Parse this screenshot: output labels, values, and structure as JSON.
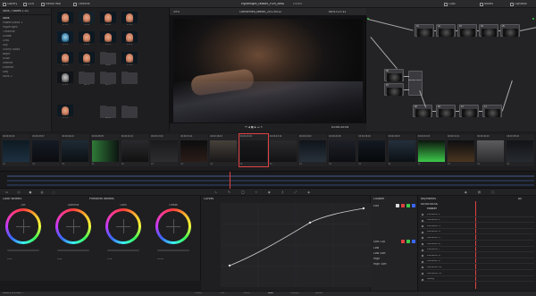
{
  "topbar": {
    "left_items": [
      "Gallery",
      "LUTs",
      "Media Pool",
      "Timeline"
    ],
    "project_title": "Hyperlight_teaser_FOR_BMD",
    "project_status": "Edited",
    "right_items": [
      "Clips",
      "Nodes",
      "Lightbox"
    ],
    "zoom": "49%",
    "viewer_title": "Conformed_teaser_20170512",
    "timecode": "00:57:27:11"
  },
  "gallery": {
    "header": "Stills / Stores 1-01",
    "list": [
      "Stills",
      "PowerGrade 1",
      "Hyperlight",
      "Timeline",
      "Grade",
      "CMA",
      "Sky",
      "Sunny looks",
      "Night",
      "Dusk",
      "Interior",
      "Exterior",
      "Day",
      "Stills 2"
    ],
    "captions": [
      "1.1.1",
      "1.1.2",
      "1.1.3",
      "1.1.4",
      "1.2.1",
      "1.2.2",
      "1.2.3",
      "1.2.4",
      "1.3.1",
      "1.3.2",
      "Stills",
      "1.3.4",
      "1.4.1",
      "Bin 4",
      "Bin 5",
      "",
      "1.5.1",
      "",
      "Bin 6",
      ""
    ]
  },
  "viewer": {
    "timecode": "01:00:20:04"
  },
  "nodes": {
    "labels": [
      "01",
      "02",
      "03",
      "04",
      "05",
      "06",
      "07",
      "Parallel Mixer",
      "08",
      "09",
      "10",
      "11"
    ]
  },
  "timeline_clips": {
    "timecodes": [
      "00:00:00:24",
      "00:00:03:07",
      "00:00:06:10",
      "00:00:08:05",
      "00:00:10:21",
      "00:00:13:00",
      "00:00:15:11",
      "00:00:18:22",
      "00:00:20:04",
      "00:00:22:14",
      "00:00:24:09",
      "00:00:26:18",
      "00:00:28:02",
      "00:00:30:15",
      "00:00:32:03",
      "00:00:34:11",
      "00:00:36:20",
      "00:00:38:04"
    ],
    "name": "V1"
  },
  "color_wheels": {
    "header": "Color Wheels",
    "mode": "Primaries Wheels",
    "wheels": [
      "Lift",
      "Gamma",
      "Gain",
      "Offset"
    ],
    "values": [
      "0.00",
      "0.00",
      "0.00",
      "0.00",
      "1.00",
      "1.00",
      "1.00",
      "1.00",
      "25.00",
      "0.00",
      "0.00",
      "0.00"
    ]
  },
  "curves": {
    "header": "Curves"
  },
  "curve_edit": {
    "header": "Custom",
    "edit": "Edit",
    "soft_clip": "Soft Clip",
    "low": "Low",
    "low_soft": "Low Soft",
    "high": "High",
    "high_soft": "High Soft"
  },
  "keyframes": {
    "header": "Keyframes",
    "filter": "All",
    "timecode": "00:00:00:00",
    "master": "Master",
    "corrector_label": "Corrector",
    "rows": [
      "Corrector 1",
      "Corrector 2",
      "Corrector 3",
      "Corrector 4",
      "Corrector 5",
      "Corrector 6",
      "Corrector 7",
      "Corrector 8",
      "Corrector 9",
      "Corrector 10",
      "Corrector 11",
      "Sizing"
    ]
  },
  "bottom": {
    "tabs": [
      "Media",
      "Edit",
      "Fusion",
      "Color",
      "Fairlight",
      "Deliver"
    ],
    "active": "Color",
    "status": "Gallery Window 1"
  },
  "colors": {
    "accent": "#e04141",
    "curve": "#cfcfcf",
    "track": "#3a4a78"
  }
}
